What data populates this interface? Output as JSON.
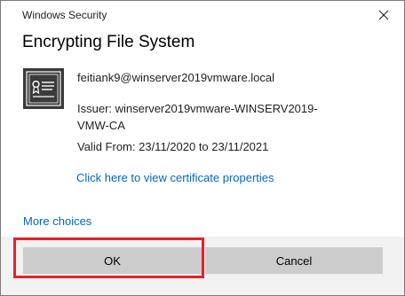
{
  "window": {
    "title": "Windows Security"
  },
  "dialog": {
    "heading": "Encrypting File System"
  },
  "certificate": {
    "icon": "certificate-icon",
    "subject": "feitiank9@winserver2019vmware.local",
    "issuer_line1": "Issuer: winserver2019vmware-WINSERV2019-",
    "issuer_line2": "VMW-CA",
    "valid": "Valid From: 23/11/2020 to 23/11/2021",
    "properties_link": "Click here to view certificate properties"
  },
  "more_choices": "More choices",
  "buttons": {
    "ok": "OK",
    "cancel": "Cancel"
  },
  "colors": {
    "link": "#0067c0",
    "button": "#cccccc",
    "highlight": "#e8202a",
    "icon_dark": "#3b3b3b"
  }
}
